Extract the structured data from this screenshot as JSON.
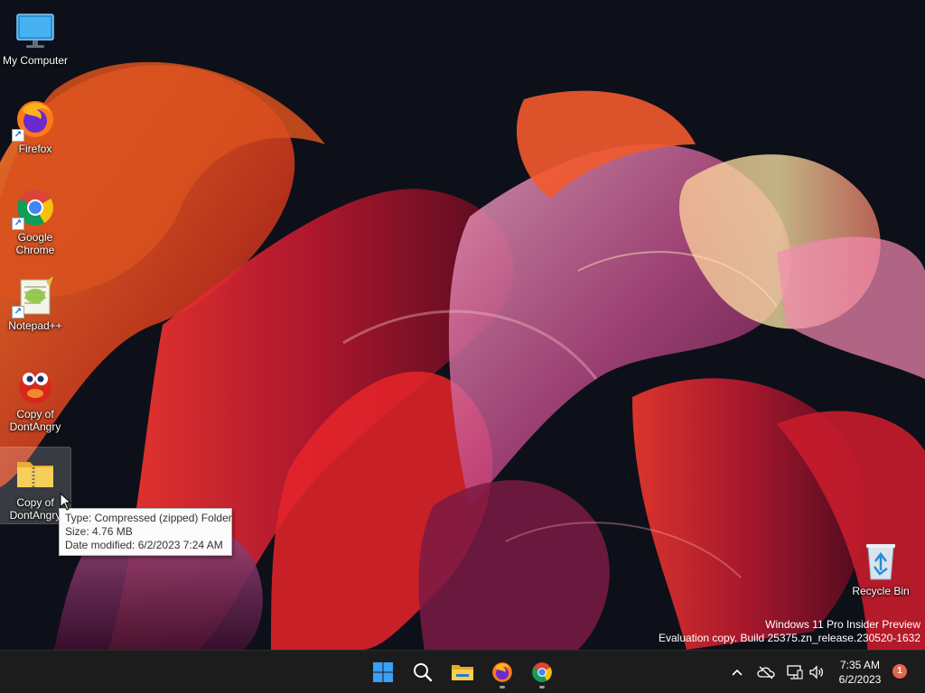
{
  "desktop": {
    "icons": [
      {
        "label": "My Computer"
      },
      {
        "label": "Firefox"
      },
      {
        "label": "Google Chrome"
      },
      {
        "label": "Notepad++"
      },
      {
        "label": "Copy of DontAngry"
      },
      {
        "label": "Copy of DontAngry"
      },
      {
        "label": "Recycle Bin"
      }
    ],
    "tooltip": {
      "type": "Type: Compressed (zipped) Folder",
      "size": "Size: 4.76 MB",
      "date": "Date modified: 6/2/2023 7:24 AM"
    },
    "watermark": {
      "line1": "Windows 11 Pro Insider Preview",
      "line2": "Evaluation copy. Build 25375.zn_release.230520-1632"
    }
  },
  "taskbar": {
    "pinned": [
      {
        "icon": "windows-start-icon"
      },
      {
        "icon": "search-icon"
      },
      {
        "icon": "file-explorer-icon"
      },
      {
        "icon": "firefox-icon",
        "running": true
      },
      {
        "icon": "chrome-icon",
        "running": true
      }
    ],
    "tray": {
      "time": "7:35 AM",
      "date": "6/2/2023",
      "notification_count": "1"
    }
  },
  "colors": {
    "taskbar_bg": "#1c1c1c",
    "accent_blue": "#3aa0f3",
    "folder_yellow": "#f2c94c",
    "notification_badge": "#e8654a"
  }
}
